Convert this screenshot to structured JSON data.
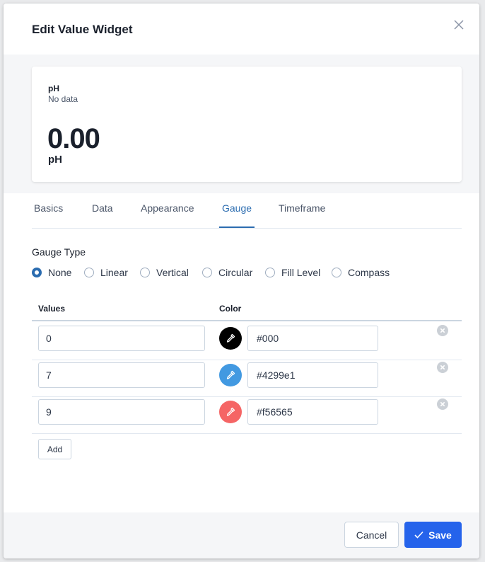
{
  "dialog": {
    "title": "Edit Value Widget"
  },
  "preview": {
    "title": "pH",
    "subtitle": "No data",
    "value": "0.00",
    "unit": "pH"
  },
  "tabs": [
    {
      "label": "Basics",
      "active": false
    },
    {
      "label": "Data",
      "active": false
    },
    {
      "label": "Appearance",
      "active": false
    },
    {
      "label": "Gauge",
      "active": true
    },
    {
      "label": "Timeframe",
      "active": false
    }
  ],
  "gauge_type": {
    "label": "Gauge Type",
    "selected": "None",
    "options": [
      "None",
      "Linear",
      "Vertical",
      "Circular",
      "Fill Level",
      "Compass"
    ]
  },
  "thresholds": {
    "headers": {
      "values": "Values",
      "color": "Color"
    },
    "rows": [
      {
        "value": "0",
        "color": "#000"
      },
      {
        "value": "7",
        "color": "#4299e1"
      },
      {
        "value": "9",
        "color": "#f56565"
      }
    ],
    "add_label": "Add"
  },
  "footer": {
    "cancel_label": "Cancel",
    "save_label": "Save"
  },
  "icons": {
    "close": "close-icon",
    "eyedropper": "eyedropper-icon",
    "remove": "remove-circle-icon",
    "check": "check-icon"
  },
  "colors": {
    "accent": "#2b6cb0",
    "save_button": "#2563eb"
  }
}
